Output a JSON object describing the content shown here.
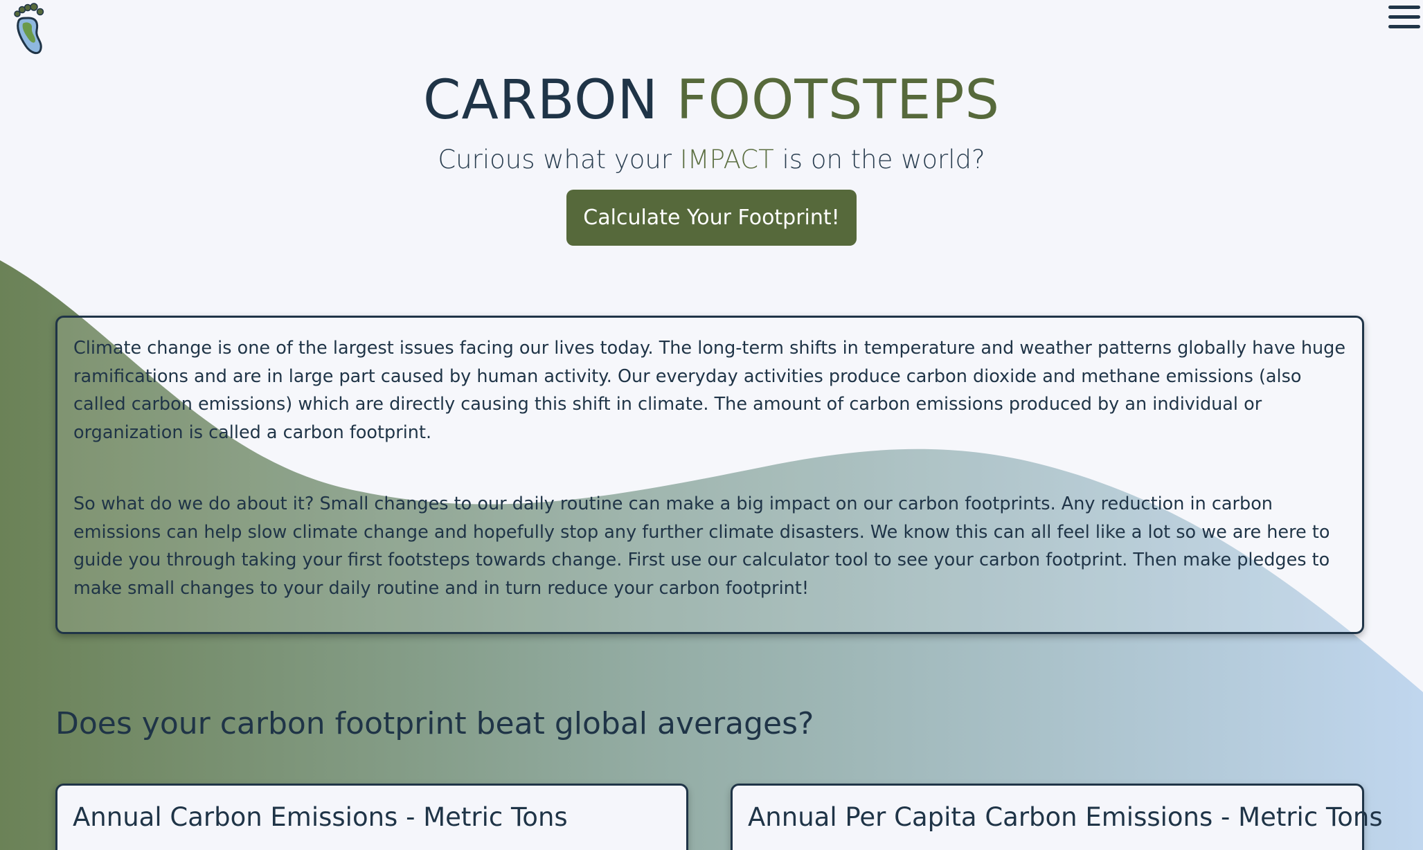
{
  "header": {
    "logo_icon": "footprint-icon",
    "menu_icon": "hamburger-menu-icon"
  },
  "hero": {
    "title_part1": "CARBON",
    "title_part2": "FOOTSTEPS",
    "tagline_before": "Curious what your ",
    "tagline_accent": "IMPACT",
    "tagline_after": " is on the world?",
    "cta_label": "Calculate Your Footprint!"
  },
  "intro": {
    "paragraph1": "Climate change is one of the largest issues facing our lives today. The long-term shifts in temperature and weather patterns globally have huge ramifications and are in large part caused by human activity. Our everyday activities produce carbon dioxide and methane emissions (also called carbon emissions) which are directly causing this shift in climate. The amount of carbon emissions produced by an individual or organization is called a carbon footprint.",
    "paragraph2": "So what do we do about it? Small changes to our daily routine can make a big impact on our carbon footprints. Any reduction in carbon emissions can help slow climate change and hopefully stop any further climate disasters. We know this can all feel like a lot so we are here to guide you through taking your first footsteps towards change. First use our calculator tool to see your carbon footprint. Then make pledges to make small changes to your daily routine and in turn reduce your carbon footprint!"
  },
  "averages": {
    "heading": "Does your carbon footprint beat global averages?",
    "cards": [
      {
        "title": "Annual Carbon Emissions - Metric Tons"
      },
      {
        "title": "Annual Per Capita Carbon Emissions - Metric Tons"
      }
    ]
  },
  "colors": {
    "brand_green": "#56693b",
    "navy": "#1f3447",
    "background": "#f5f6fb",
    "wave_green": "#6b8257",
    "wave_blue": "#bcd4ec"
  }
}
